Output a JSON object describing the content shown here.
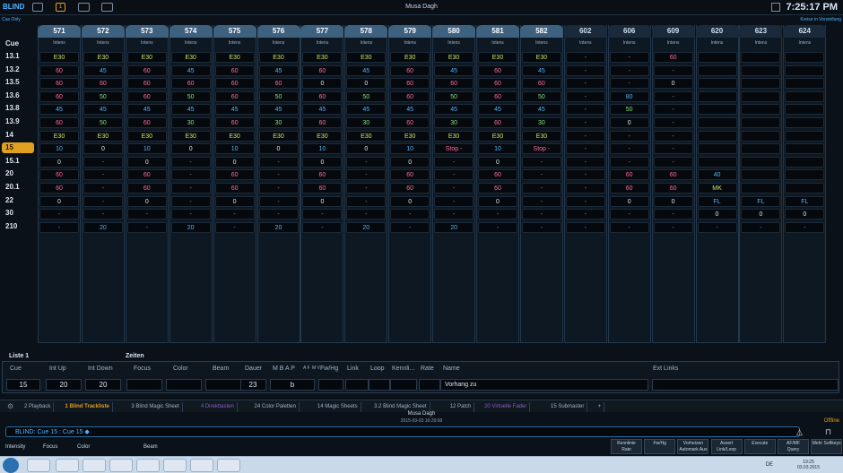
{
  "header": {
    "mode": "BLIND",
    "mode_badge": "1",
    "show": "Musa Dagh",
    "clock": "7:25:17 PM",
    "cue_only": "Cue Only",
    "kreise": "Kreise in Vorstellung"
  },
  "cue_header": "Cue",
  "channels": [
    "571",
    "572",
    "573",
    "574",
    "575",
    "576",
    "577",
    "578",
    "579",
    "580",
    "581",
    "582",
    "602",
    "606",
    "609",
    "620",
    "623",
    "624"
  ],
  "channel_param": "Intens",
  "cues": [
    "13.1",
    "13.2",
    "13.5",
    "13.6",
    "13.8",
    "13.9",
    "14",
    "15",
    "15.1",
    "20",
    "20.1",
    "22",
    "30",
    "210"
  ],
  "selected_cue": "15",
  "cells": [
    [
      "E30",
      "E30",
      "E30",
      "E30",
      "E30",
      "E30",
      "E30",
      "E30",
      "E30",
      "E30",
      "E30",
      "E30",
      "-",
      "-",
      "60",
      "",
      "",
      ""
    ],
    [
      "60",
      "45",
      "60",
      "45",
      "60",
      "45",
      "60",
      "45",
      "60",
      "45",
      "60",
      "45",
      "-",
      "-",
      "-",
      "",
      "",
      ""
    ],
    [
      "60",
      "60",
      "60",
      "60",
      "60",
      "60",
      "0",
      "0",
      "60",
      "60",
      "60",
      "60",
      "-",
      "-",
      "0",
      "",
      "",
      ""
    ],
    [
      "60",
      "50",
      "60",
      "50",
      "60",
      "50",
      "60",
      "50",
      "60",
      "50",
      "60",
      "50",
      "-",
      "80",
      "-",
      "",
      "",
      ""
    ],
    [
      "45",
      "45",
      "45",
      "45",
      "45",
      "45",
      "45",
      "45",
      "45",
      "45",
      "45",
      "45",
      "-",
      "50",
      "-",
      "",
      "",
      ""
    ],
    [
      "60",
      "50",
      "60",
      "30",
      "60",
      "30",
      "60",
      "30",
      "60",
      "30",
      "60",
      "30",
      "-",
      "0",
      "-",
      "",
      "",
      ""
    ],
    [
      "E30",
      "E30",
      "E30",
      "E30",
      "E30",
      "E30",
      "E30",
      "E30",
      "E30",
      "E30",
      "E30",
      "E30",
      "-",
      "-",
      "-",
      "",
      "",
      ""
    ],
    [
      "10",
      "0",
      "10",
      "0",
      "10",
      "0",
      "10",
      "0",
      "10",
      "Stop -",
      "10",
      "Stop -",
      "-",
      "-",
      "-",
      "",
      "",
      ""
    ],
    [
      "0",
      "-",
      "0",
      "-",
      "0",
      "-",
      "0",
      "-",
      "0",
      "-",
      "0",
      "-",
      "-",
      "-",
      "-",
      "",
      "",
      ""
    ],
    [
      "60",
      "-",
      "60",
      "-",
      "60",
      "-",
      "60",
      "-",
      "60",
      "-",
      "60",
      "-",
      "-",
      "60",
      "60",
      "40",
      "",
      ""
    ],
    [
      "60",
      "-",
      "60",
      "-",
      "60",
      "-",
      "60",
      "-",
      "60",
      "-",
      "60",
      "-",
      "-",
      "60",
      "60",
      "MK",
      "",
      ""
    ],
    [
      "0",
      "-",
      "0",
      "-",
      "0",
      "-",
      "0",
      "-",
      "0",
      "-",
      "0",
      "-",
      "-",
      "0",
      "0",
      "FL",
      "FL",
      "FL"
    ],
    [
      "-",
      "-",
      "-",
      "-",
      "-",
      "-",
      "-",
      "-",
      "-",
      "-",
      "-",
      "-",
      "-",
      "-",
      "-",
      "0",
      "0",
      "0"
    ],
    [
      "-",
      "20",
      "-",
      "20",
      "-",
      "20",
      "-",
      "20",
      "-",
      "20",
      "-",
      "-",
      "-",
      "-",
      "-",
      "-",
      "-",
      "-"
    ]
  ],
  "colors": {
    "E30": "#c6e46a",
    "60": "#ff6aa6",
    "45": "#4fb4ff",
    "50": "#7fe07f",
    "30": "#7fe07f",
    "0": "#d8e6f4",
    "10": "#4fb4ff",
    "20": "#4fb4ff",
    "80": "#4fb4ff",
    "40": "#4fb4ff",
    "MK": "#c6e46a",
    "FL": "#4fb4ff",
    "Stop -": "#ff6aa6",
    "-": "#8a9cb0"
  },
  "list_title": "Liste 1",
  "zeiten_label": "Zeiten",
  "panel": {
    "headers": [
      "Cue",
      "Int Up",
      "Int Down",
      "Focus",
      "Color",
      "Beam",
      "Dauer",
      "M B A P",
      "A F",
      "M V",
      "Fw/Hg",
      "Link",
      "Loop",
      "Kennli...",
      "Rate",
      "Name",
      "Ext Links"
    ],
    "cue": "15",
    "int_up": "20",
    "int_down": "20",
    "dauer": "23",
    "mbap": "b",
    "name": "Vorhang zu"
  },
  "tabs": [
    {
      "label": "2 Playback"
    },
    {
      "label": "1 Blind Trackliste"
    },
    {
      "label": "3 Blind Magic Sheet"
    },
    {
      "label": "4 Direkttasten"
    },
    {
      "label": "24 Color Paletten"
    },
    {
      "label": "14 Magic Sheets"
    },
    {
      "label": "3.2 Blind Magic Sheet"
    },
    {
      "label": "12 Patch"
    },
    {
      "label": "20 Virtuelle Fader"
    },
    {
      "label": "15 Submaster"
    },
    {
      "label": "+"
    }
  ],
  "footer": {
    "show": "Musa Dagh",
    "date": "2015-03-03 16:29:08",
    "cmdline": "BLIND: Cue  15 :  Cue 15 ◆",
    "offline": "Offline"
  },
  "leftkeys": [
    "Intensity",
    "Focus",
    "Color",
    "Beam"
  ],
  "softkeys": [
    {
      "l1": "Kennlinie",
      "l2": "Rate"
    },
    {
      "l1": "",
      "l2": "Fw/Hg"
    },
    {
      "l1": "Vorheizen",
      "l2": "Automark Aus"
    },
    {
      "l1": "Assert",
      "l2": "Link/Loop"
    },
    {
      "l1": "",
      "l2": "Execute"
    },
    {
      "l1": "AF/MF",
      "l2": "Query"
    },
    {
      "l1": "",
      "l2": "Mehr Softkeys"
    }
  ],
  "tray": {
    "lang": "DE",
    "time": "19:25",
    "date": "03.03.2015"
  }
}
